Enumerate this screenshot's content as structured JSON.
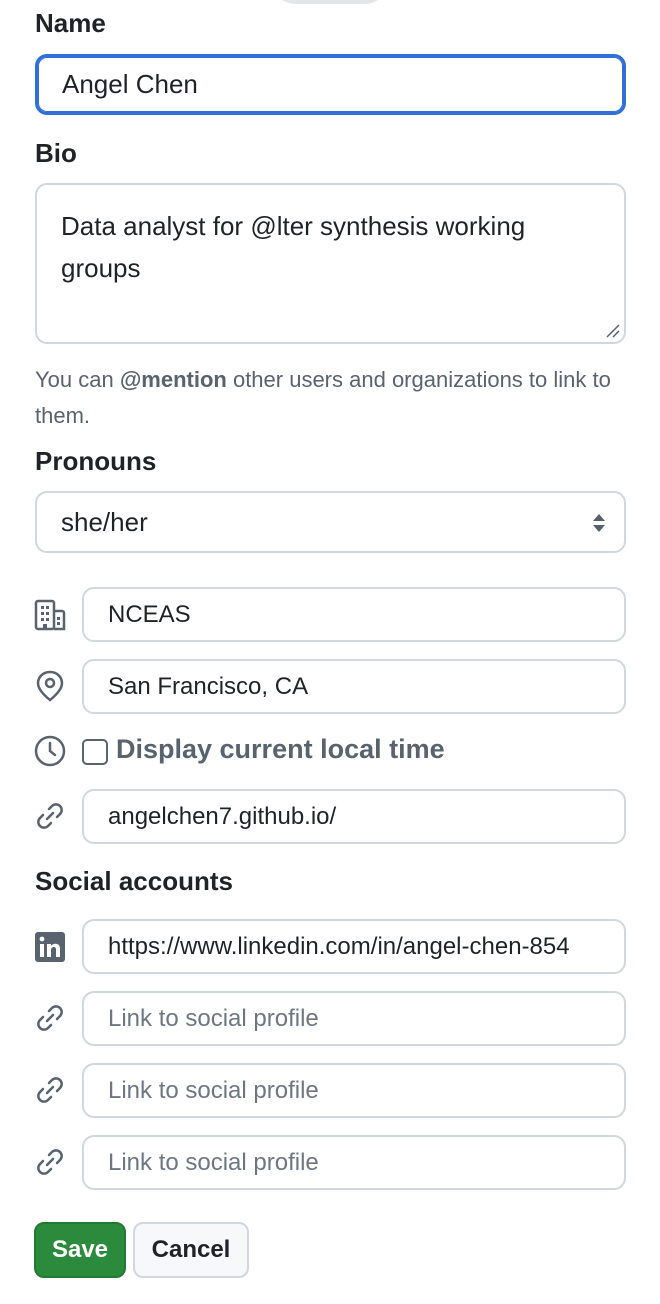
{
  "name": {
    "label": "Name",
    "value": "Angel Chen"
  },
  "bio": {
    "label": "Bio",
    "value": "Data analyst for @lter synthesis working groups",
    "help_prefix": "You can ",
    "help_bold": "@mention",
    "help_suffix": " other users and organizations to link to them."
  },
  "pronouns": {
    "label": "Pronouns",
    "value": "she/her"
  },
  "company": {
    "icon": "organization-icon",
    "value": "NCEAS"
  },
  "location": {
    "icon": "location-icon",
    "value": "San Francisco, CA"
  },
  "local_time": {
    "icon": "clock-icon",
    "label": "Display current local time",
    "checked": false
  },
  "website": {
    "icon": "link-icon",
    "value": "angelchen7.github.io/"
  },
  "social": {
    "label": "Social accounts",
    "accounts": [
      {
        "icon": "linkedin-icon",
        "value": "https://www.linkedin.com/in/angel-chen-854"
      },
      {
        "icon": "link-icon",
        "placeholder": "Link to social profile"
      },
      {
        "icon": "link-icon",
        "placeholder": "Link to social profile"
      },
      {
        "icon": "link-icon",
        "placeholder": "Link to social profile"
      }
    ]
  },
  "actions": {
    "save_label": "Save",
    "cancel_label": "Cancel"
  },
  "colors": {
    "focus_border": "#2f6fd6",
    "save_button": "#2c8a3c",
    "border": "#d0d7de",
    "muted_text": "#59636e"
  }
}
